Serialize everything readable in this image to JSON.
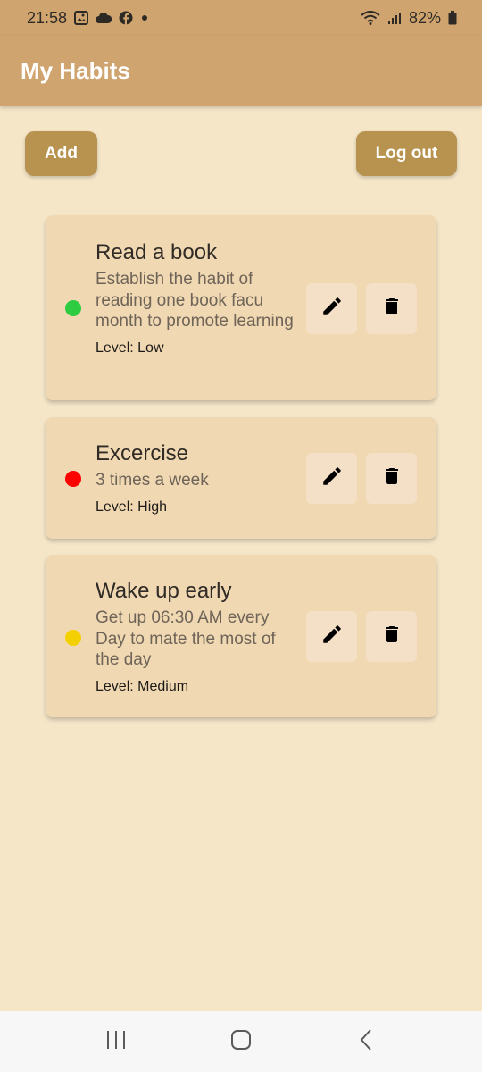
{
  "status_bar": {
    "time": "21:58",
    "battery": "82%",
    "notification_icons": [
      "gallery-icon",
      "cloud-icon",
      "facebook-icon",
      "dot-icon"
    ],
    "system_icons": [
      "wifi-icon",
      "signal-icon",
      "battery-icon"
    ]
  },
  "app_bar": {
    "title": "My Habits"
  },
  "actions": {
    "add_label": "Add",
    "logout_label": "Log out"
  },
  "habits": [
    {
      "title": "Read a book",
      "description": "Establish the habit of reading one book facu month to promote learning",
      "level": "Level: Low",
      "status_color": "#2ecc40"
    },
    {
      "title": "Excercise",
      "description": "3 times a week",
      "level": "Level: High",
      "status_color": "#ff0000"
    },
    {
      "title": "Wake up early",
      "description": "Get up 06:30 AM every Day to mate the most of the day",
      "level": "Level: Medium",
      "status_color": "#f5d000"
    }
  ],
  "nav": {
    "buttons": [
      "recent-apps-icon",
      "home-icon",
      "back-icon"
    ]
  },
  "colors": {
    "app_bar": "#cfa46f",
    "background": "#f5e6c8",
    "card": "#f0d8b2",
    "button": "#b8934f"
  }
}
